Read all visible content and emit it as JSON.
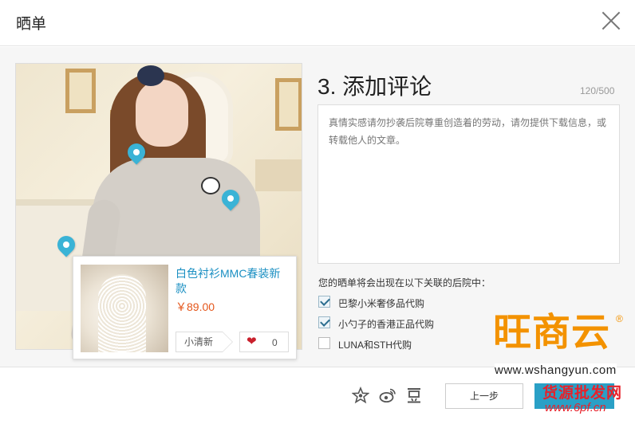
{
  "dialog": {
    "title": "晒单",
    "close_icon": "close-icon"
  },
  "editor": {
    "section_title": "3. 添加评论",
    "char_counter": "120/500",
    "comment_placeholder": "真情实感请勿抄袭后院尊重创造着的劳动，请勿提供下载信息，或转载他人的文章。"
  },
  "product_card": {
    "name": "白色衬衫MMC春装新款",
    "price": "￥89.00",
    "tag": "小清新",
    "like_count": "0",
    "like_icon": "heart-icon"
  },
  "backyards": {
    "label": "您的晒单将会出现在以下关联的后院中：",
    "options": [
      {
        "label": "巴黎小米奢侈品代购",
        "checked": true
      },
      {
        "label": "小勺子的香港正品代购",
        "checked": true
      },
      {
        "label": "LUNA和STH代购",
        "checked": false
      }
    ]
  },
  "footer": {
    "icons": [
      "star-icon",
      "weibo-icon",
      "douban-icon"
    ],
    "prev_label": "上一步",
    "next_label": ""
  },
  "watermark": {
    "logo": "旺商云",
    "registered": "®",
    "url": "www.wshangyun.com",
    "red_text": "货源批发网",
    "red_url": "www.6pf.cn"
  },
  "colors": {
    "accent": "#2aa0c6",
    "link": "#1a8fc2",
    "price": "#e4561b",
    "pin": "#3ab3d6",
    "logo": "#f39200",
    "red": "#e8212a"
  }
}
